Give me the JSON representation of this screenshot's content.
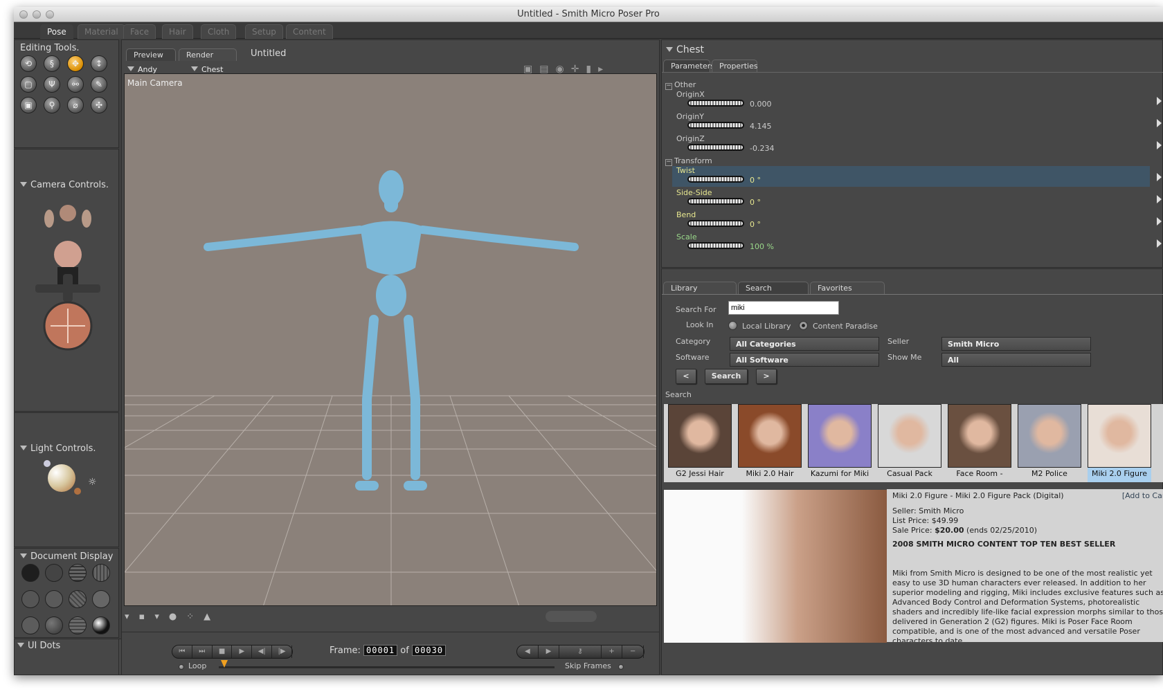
{
  "window": {
    "title": "Untitled - Smith Micro Poser Pro"
  },
  "rooms": [
    "Pose",
    "Material",
    "Face",
    "Hair",
    "Cloth",
    "Setup",
    "Content"
  ],
  "left": {
    "editing_tools": "Editing Tools.",
    "tools": [
      {
        "name": "rotate",
        "glyph": "⟲"
      },
      {
        "name": "twist",
        "glyph": "§"
      },
      {
        "name": "translate",
        "glyph": "✥",
        "active": true
      },
      {
        "name": "translate-in-out",
        "glyph": "↕"
      },
      {
        "name": "scale",
        "glyph": "▢"
      },
      {
        "name": "taper",
        "glyph": "Ψ"
      },
      {
        "name": "chain-break",
        "glyph": "⚯"
      },
      {
        "name": "color",
        "glyph": "✎"
      },
      {
        "name": "grouping",
        "glyph": "▣"
      },
      {
        "name": "view-magnifier",
        "glyph": "⚲"
      },
      {
        "name": "morphing",
        "glyph": "⌀"
      },
      {
        "name": "direct-manipulation",
        "glyph": "✣"
      }
    ],
    "camera_controls": "Camera Controls.",
    "light_controls": "Light Controls.",
    "document_display": "Document Display",
    "ui_dots": "UI Dots"
  },
  "viewport": {
    "tabs": [
      "Preview",
      "Render"
    ],
    "document_title": "Untitled",
    "figure": "Andy",
    "actor": "Chest",
    "camera": "Main Camera",
    "figure_color": "#7cb8d8",
    "bg_color": "#8b817a"
  },
  "animation": {
    "frame_label": "Frame:",
    "frame": "00001",
    "of_label": "of",
    "total": "00030",
    "loop": "Loop",
    "skip_frames": "Skip Frames"
  },
  "params": {
    "actor": "Chest",
    "tabs": [
      "Parameters",
      "Properties"
    ],
    "groups": [
      {
        "name": "Other",
        "items": [
          {
            "label": "OriginX",
            "value": "0.000"
          },
          {
            "label": "OriginY",
            "value": "4.145"
          },
          {
            "label": "OriginZ",
            "value": "-0.234"
          }
        ]
      },
      {
        "name": "Transform",
        "items": [
          {
            "label": "Twist",
            "value": "0 °",
            "selected": true
          },
          {
            "label": "Side-Side",
            "value": "0 °"
          },
          {
            "label": "Bend",
            "value": "0 °"
          },
          {
            "label": "Scale",
            "value": "100 %"
          }
        ]
      }
    ]
  },
  "library": {
    "tabs": [
      "Library",
      "Search",
      "Favorites"
    ],
    "search_for_label": "Search For",
    "search_value": "miki",
    "look_in_label": "Look In",
    "local_library": "Local Library",
    "content_paradise": "Content Paradise",
    "category_label": "Category",
    "category": "All Categories",
    "software_label": "Software",
    "software": "All Software",
    "seller_label": "Seller",
    "seller": "Smith Micro",
    "show_me_label": "Show Me",
    "show_me": "All",
    "prev": "<",
    "search_button": "Search",
    "next": ">",
    "results_label": "Search",
    "results": [
      {
        "caption": "G2 Jessi Hair",
        "color": "#5a4438"
      },
      {
        "caption": "Miki 2.0 Hair",
        "color": "#8a4a2a"
      },
      {
        "caption": "Kazumi for Miki",
        "color": "#8a80c8"
      },
      {
        "caption": "Casual Pack",
        "color": "#d8d8d8"
      },
      {
        "caption": "Face Room -",
        "color": "#6a5040"
      },
      {
        "caption": "M2 Police",
        "color": "#9aa0b0"
      },
      {
        "caption": "Miki 2.0 Figure",
        "color": "#e8ded6",
        "selected": true
      }
    ],
    "detail": {
      "title": "Miki 2.0 Figure - Miki 2.0 Figure Pack (Digital)",
      "add_to_cart": "[Add to Cart]",
      "seller": "Seller: Smith Micro",
      "list_price": "List Price: $49.99",
      "sale_prefix": "Sale Price:",
      "sale_price": "$20.00",
      "sale_suffix": "(ends 02/25/2010)",
      "headline": "2008 SMITH MICRO CONTENT TOP TEN BEST SELLER",
      "description": "Miki from Smith Micro is designed to be one of the most realistic yet easy to use 3D human characters ever released. In addition to her superior modeling and rigging, Miki includes exclusive features such as Advanced Body Control and Deformation Systems, photorealistic shaders and incredibly life-like facial expression morphs similar to those delivered in Generation 2 (G2) figures. Miki is Poser Face Room compatible, and is one of the most advanced and versatile Poser characters to date."
    }
  }
}
